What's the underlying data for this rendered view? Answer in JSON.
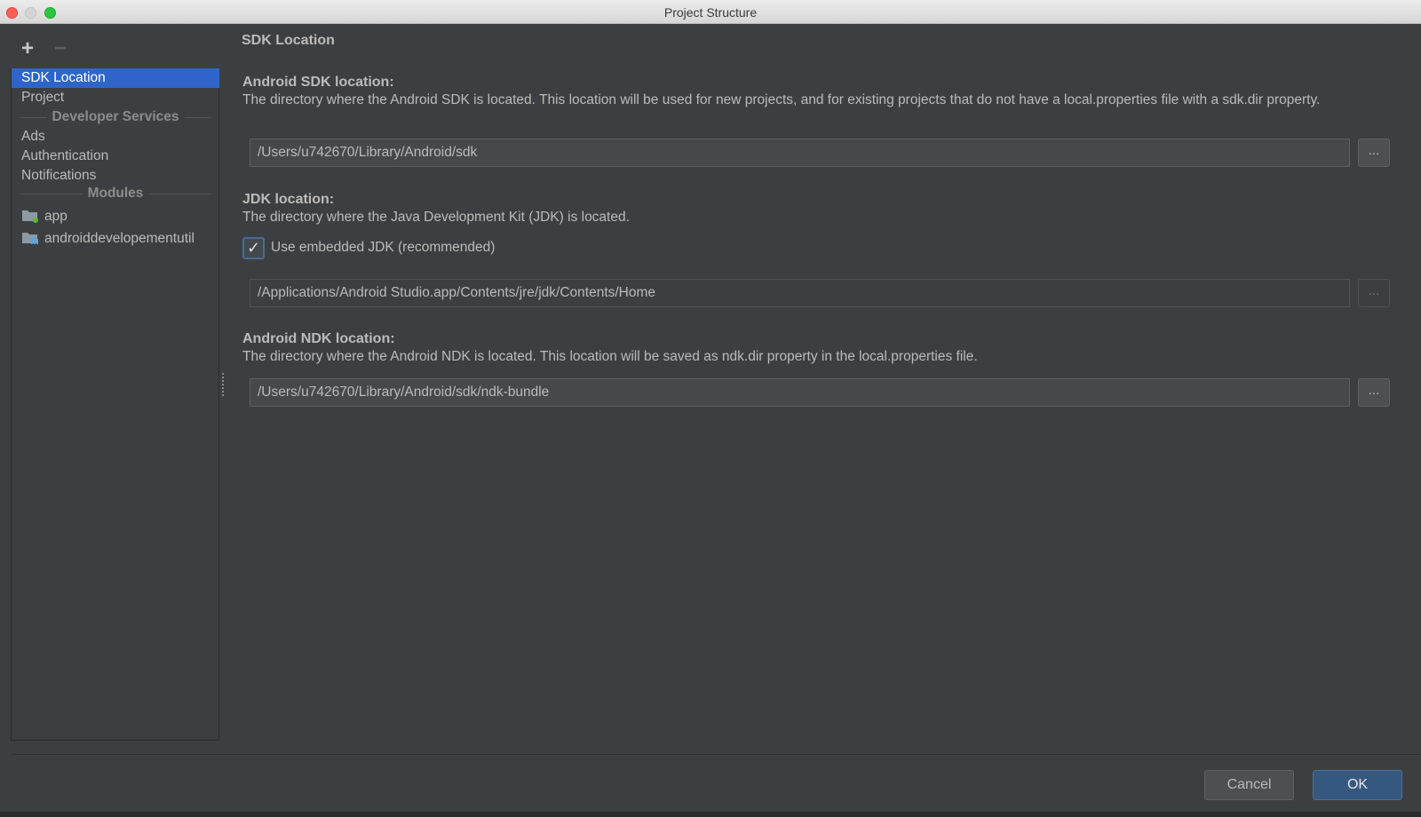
{
  "window": {
    "title": "Project Structure"
  },
  "sidebar": {
    "add_icon": "plus-icon",
    "remove_icon": "minus-icon",
    "items": [
      {
        "label": "SDK Location",
        "selected": true
      },
      {
        "label": "Project",
        "selected": false
      }
    ],
    "groups": {
      "developer_services": {
        "label": "Developer Services",
        "items": [
          {
            "label": "Ads"
          },
          {
            "label": "Authentication"
          },
          {
            "label": "Notifications"
          }
        ]
      },
      "modules": {
        "label": "Modules",
        "items": [
          {
            "label": "app",
            "icon": "module-folder-icon"
          },
          {
            "label": "androiddevelopementutil",
            "icon": "library-module-icon"
          }
        ]
      }
    }
  },
  "main": {
    "title": "SDK Location",
    "android_sdk": {
      "title": "Android SDK location:",
      "description": "The directory where the Android SDK is located. This location will be used for new projects, and for existing projects that do not have a local.properties file with a sdk.dir property.",
      "path": "/Users/u742670/Library/Android/sdk",
      "browse_label": "..."
    },
    "jdk": {
      "title": "JDK location:",
      "description": "The directory where the Java Development Kit (JDK) is located.",
      "embedded_label": "Use embedded JDK (recommended)",
      "embedded_checked": true,
      "path": "/Applications/Android Studio.app/Contents/jre/jdk/Contents/Home",
      "browse_label": "..."
    },
    "ndk": {
      "title": "Android NDK location:",
      "description": "The directory where the Android NDK is located. This location will be saved as ndk.dir property in the local.properties file.",
      "path": "/Users/u742670/Library/Android/sdk/ndk-bundle",
      "browse_label": "..."
    }
  },
  "footer": {
    "cancel_label": "Cancel",
    "ok_label": "OK"
  },
  "colors": {
    "background": "#3c3f41",
    "selection": "#2f65ca",
    "primary_button": "#365880"
  }
}
